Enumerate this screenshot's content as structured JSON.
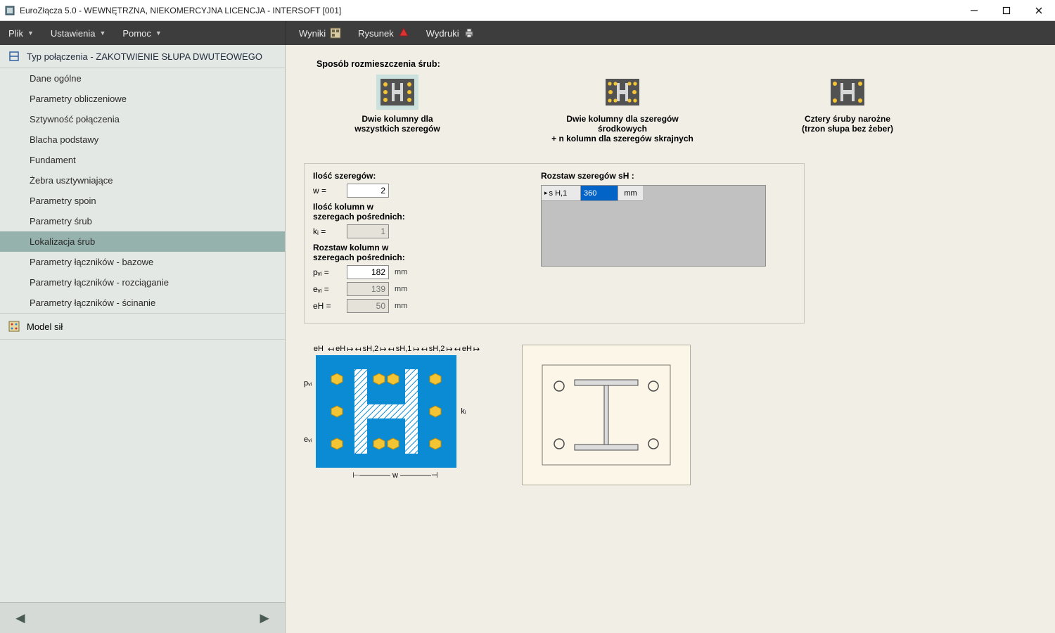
{
  "window": {
    "title": "EuroZłącza 5.0 - WEWNĘTRZNA, NIEKOMERCYJNA LICENCJA - INTERSOFT [001]"
  },
  "menu": {
    "left": [
      "Plik",
      "Ustawienia",
      "Pomoc"
    ],
    "right": [
      "Wyniki",
      "Rysunek",
      "Wydruki"
    ]
  },
  "sidebar": {
    "header": "Typ połączenia - ZAKOTWIENIE SŁUPA DWUTEOWEGO",
    "items": [
      "Dane ogólne",
      "Parametry obliczeniowe",
      "Sztywność połączenia",
      "Blacha podstawy",
      "Fundament",
      "Żebra usztywniające",
      "Parametry spoin",
      "Parametry śrub",
      "Lokalizacja śrub",
      "Parametry łączników - bazowe",
      "Parametry łączników - rozciąganie",
      "Parametry łączników - ścinanie"
    ],
    "active_index": 8,
    "footer": "Model sił"
  },
  "options": {
    "title": "Sposób rozmieszczenia śrub:",
    "items": [
      {
        "line1": "Dwie kolumny dla",
        "line2": "wszystkich szeregów"
      },
      {
        "line1": "Dwie kolumny dla szeregów środkowych",
        "line2": "+ n kolumn dla szeregów skrajnych"
      },
      {
        "line1": "Cztery śruby narożne",
        "line2": "(trzon słupa bez żeber)"
      }
    ],
    "selected_index": 0
  },
  "params": {
    "left": {
      "rows_label": "Ilość szeregów:",
      "w_label": "w  =",
      "w_value": "2",
      "cols_label1": "Ilość kolumn w",
      "cols_label2": "szeregach pośrednich:",
      "ki_label": "kᵢ  =",
      "ki_value": "1",
      "spacing_label1": "Rozstaw kolumn w",
      "spacing_label2": "szeregach pośrednich:",
      "pvi_label": "pᵥᵢ =",
      "pvi_value": "182",
      "evi_label": "eᵥᵢ =",
      "evi_value": "139",
      "eh_label": "eH  =",
      "eh_value": "50",
      "unit": "mm"
    },
    "right": {
      "label": "Rozstaw szeregów  sH :",
      "row_header": "s H,1",
      "row_value": "360",
      "row_unit": "mm"
    }
  },
  "diagram": {
    "top_labels": {
      "eh": "eH",
      "sh2": "sH,2",
      "sh1": "sH,1"
    },
    "side_labels": {
      "pvi": "pᵥᵢ",
      "evi": "eᵥᵢ",
      "ki": "kᵢ",
      "w": "w"
    }
  }
}
